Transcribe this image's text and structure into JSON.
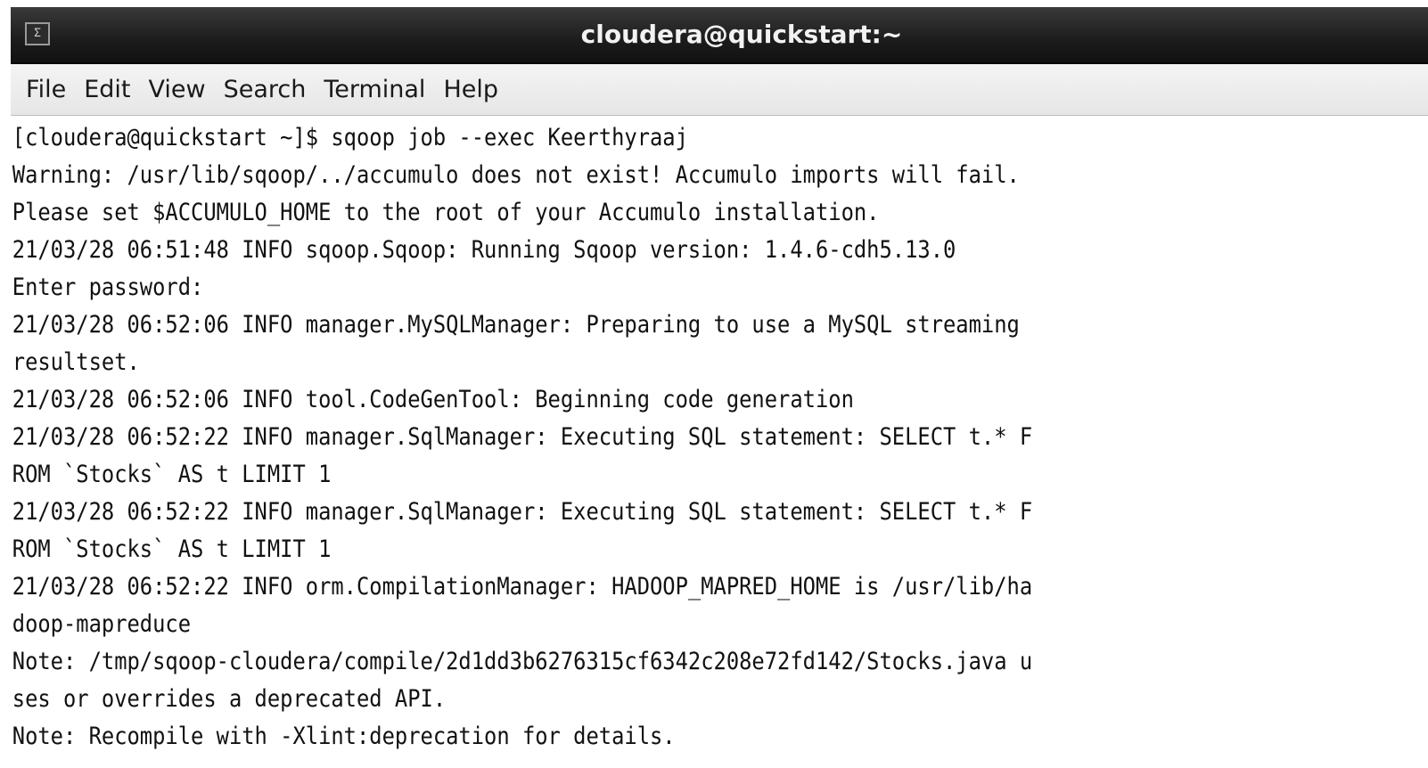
{
  "window": {
    "title": "cloudera@quickstart:~",
    "icon": "terminal-icon",
    "icon_glyph": "Σ"
  },
  "menubar": {
    "items": [
      "File",
      "Edit",
      "View",
      "Search",
      "Terminal",
      "Help"
    ]
  },
  "terminal": {
    "lines": [
      "[cloudera@quickstart ~]$ sqoop job --exec Keerthyraaj",
      "Warning: /usr/lib/sqoop/../accumulo does not exist! Accumulo imports will fail.",
      "Please set $ACCUMULO_HOME to the root of your Accumulo installation.",
      "21/03/28 06:51:48 INFO sqoop.Sqoop: Running Sqoop version: 1.4.6-cdh5.13.0",
      "Enter password:",
      "21/03/28 06:52:06 INFO manager.MySQLManager: Preparing to use a MySQL streaming",
      "resultset.",
      "21/03/28 06:52:06 INFO tool.CodeGenTool: Beginning code generation",
      "21/03/28 06:52:22 INFO manager.SqlManager: Executing SQL statement: SELECT t.* F",
      "ROM `Stocks` AS t LIMIT 1",
      "21/03/28 06:52:22 INFO manager.SqlManager: Executing SQL statement: SELECT t.* F",
      "ROM `Stocks` AS t LIMIT 1",
      "21/03/28 06:52:22 INFO orm.CompilationManager: HADOOP_MAPRED_HOME is /usr/lib/ha",
      "doop-mapreduce",
      "Note: /tmp/sqoop-cloudera/compile/2d1dd3b6276315cf6342c208e72fd142/Stocks.java u",
      "ses or overrides a deprecated API.",
      "Note: Recompile with -Xlint:deprecation for details."
    ]
  }
}
